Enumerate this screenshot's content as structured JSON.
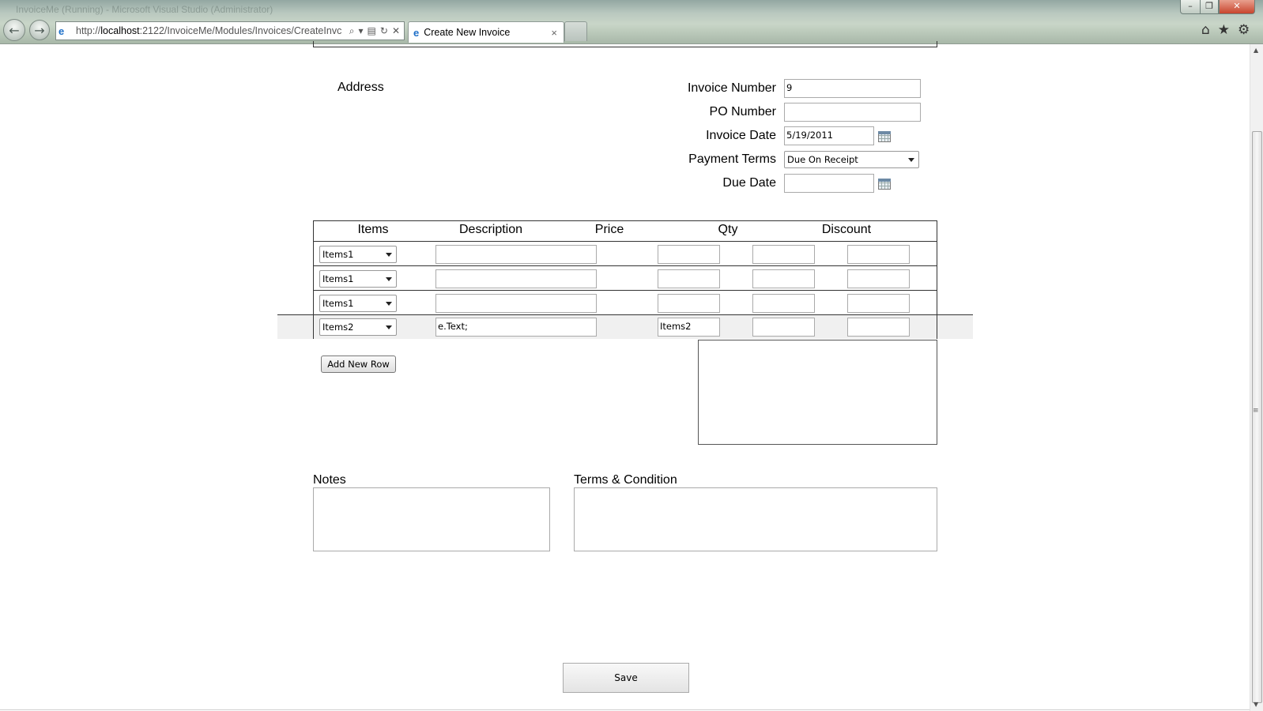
{
  "browser": {
    "window_title": "InvoiceMe (Running) - Microsoft Visual Studio (Administrator)",
    "url_prefix": "http://",
    "url_host": "localhost",
    "url_rest": ":2122/InvoiceMe/Modules/Invoices/CreateInvc",
    "tab_title": "Create New Invoice",
    "tab_close": "×",
    "window_buttons": {
      "min": "–",
      "max": "❐",
      "close": "✕"
    },
    "nav": {
      "back": "←",
      "forward": "→"
    },
    "address_tools": {
      "search": "⌕",
      "dropdown": "▾",
      "compat": "▤",
      "refresh": "↻",
      "stop": "✕"
    },
    "tools": {
      "home": "⌂",
      "favorites": "★",
      "settings": "⚙"
    }
  },
  "form": {
    "address_label": "Address",
    "invoice_number": {
      "label": "Invoice Number",
      "value": "9"
    },
    "po_number": {
      "label": "PO Number",
      "value": ""
    },
    "invoice_date": {
      "label": "Invoice Date",
      "value": "5/19/2011"
    },
    "payment_terms": {
      "label": "Payment Terms",
      "value": "Due On Receipt"
    },
    "due_date": {
      "label": "Due Date",
      "value": ""
    }
  },
  "items_table": {
    "headers": [
      "Items",
      "Description",
      "Price",
      "Qty",
      "Discount"
    ],
    "rows": [
      {
        "item": "Items1",
        "description": "",
        "price": "",
        "qty": "",
        "discount": ""
      },
      {
        "item": "Items1",
        "description": "",
        "price": "",
        "qty": "",
        "discount": ""
      },
      {
        "item": "Items1",
        "description": "",
        "price": "",
        "qty": "",
        "discount": ""
      },
      {
        "item": "Items2",
        "description": "e.Text;",
        "price": "Items2",
        "qty": "",
        "discount": ""
      }
    ]
  },
  "buttons": {
    "add_new_row": "Add New Row",
    "save": "Save"
  },
  "notes": {
    "label": "Notes",
    "value": ""
  },
  "terms": {
    "label": "Terms & Condition",
    "value": ""
  },
  "icons": {
    "calendar": "calendar-icon",
    "dropdown": "chevron-down-icon"
  }
}
